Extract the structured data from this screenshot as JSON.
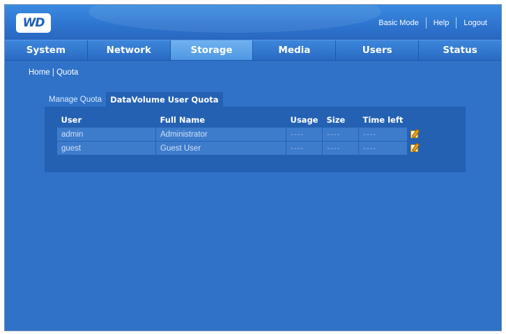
{
  "brand": {
    "logo_text": "WD"
  },
  "top_links": {
    "basic_mode": "Basic Mode",
    "help": "Help",
    "logout": "Logout"
  },
  "nav": {
    "tabs": [
      "System",
      "Network",
      "Storage",
      "Media",
      "Users",
      "Status"
    ],
    "active": "Storage"
  },
  "breadcrumb": {
    "home": "Home",
    "separator": "|",
    "current": "Quota"
  },
  "subtabs": {
    "manage": "Manage Quota",
    "active": "DataVolume User Quota"
  },
  "table": {
    "headers": [
      "User",
      "Full Name",
      "Usage",
      "Size",
      "Time left"
    ],
    "rows": [
      {
        "user": "admin",
        "full_name": "Administrator",
        "usage": "----",
        "size": "----",
        "time_left": "----"
      },
      {
        "user": "guest",
        "full_name": "Guest User",
        "usage": "----",
        "size": "----",
        "time_left": "----"
      }
    ]
  },
  "colors": {
    "background": "#2f72c8",
    "panel": "#2461b3",
    "active_tab": "#4f98e4",
    "cell": "#3d7bcb"
  },
  "icons": {
    "edit": "edit-icon"
  }
}
